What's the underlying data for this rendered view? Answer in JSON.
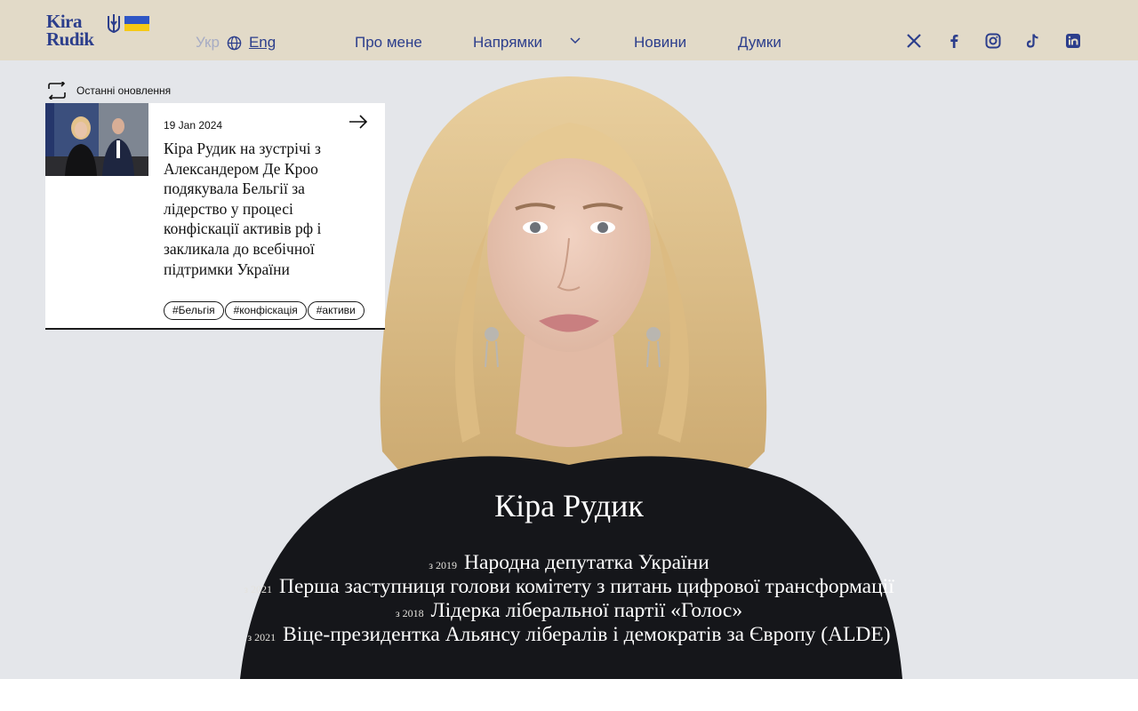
{
  "header": {
    "logo_line1": "Kira",
    "logo_line2": "Rudik",
    "lang_ukr": "Укр",
    "lang_eng": "Eng",
    "nav": {
      "about": "Про мене",
      "directions": "Напрямки",
      "news": "Новини",
      "thoughts": "Думки"
    },
    "social_icons": [
      "x-icon",
      "facebook-icon",
      "instagram-icon",
      "tiktok-icon",
      "linkedin-icon"
    ]
  },
  "updates": {
    "label": "Останні оновлення",
    "card": {
      "date": "19 Jan 2024",
      "title": "Кіра Рудик на зустрічі з Александером Де Кроо подякувала Бельгії за лідерство у процесі конфіскації активів рф і закликала до всебічної підтримки України",
      "tags": [
        "#Бельгія",
        "#конфіскація",
        "#активи"
      ]
    }
  },
  "hero": {
    "name": "Кіра Рудик",
    "roles": [
      {
        "year": "з 2019",
        "text": "Народна депутатка України"
      },
      {
        "year": "з 2021",
        "text": "Перша заступниця голови комітету з питань цифрової трансформації"
      },
      {
        "year": "з 2018",
        "text": "Лідерка ліберальної партії «Голос»"
      },
      {
        "year": "з 2021",
        "text": "Віце-президентка Альянсу лібералів і демократів за Європу (ALDE)"
      }
    ]
  },
  "colors": {
    "header_bg": "#e2dac8",
    "brand_blue": "#2c3e8c",
    "flag_blue": "#2f56c5",
    "flag_yellow": "#f5c915"
  }
}
